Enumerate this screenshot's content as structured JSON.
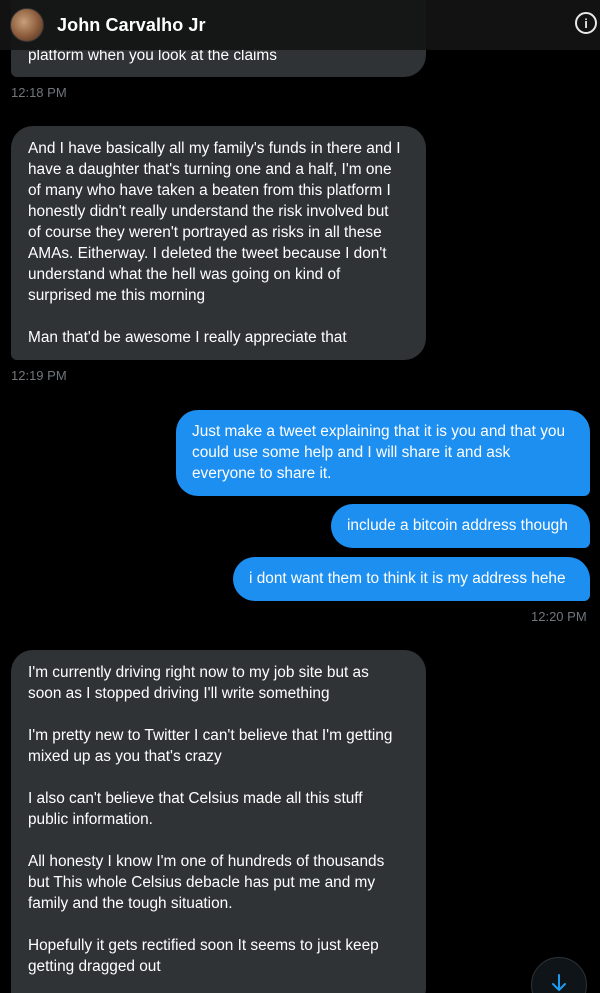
{
  "header": {
    "contact_name": "John Carvalho Jr",
    "info_icon": "info-icon"
  },
  "messages": [
    {
      "type": "received",
      "text": "platform when you look at the claims"
    },
    {
      "type": "timestamp",
      "text": "12:18 PM"
    },
    {
      "type": "received",
      "paragraphs": [
        "And I have basically all my family's funds in there and I\nhave a daughter that's turning one and a half, I'm one\nof many who have taken a beaten from this platform I\nhonestly didn't really understand the risk involved but\nof course they weren't portrayed as risks in all these\nAMAs. Eitherway. I deleted the tweet because I don't\nunderstand what the hell was going on kind of\nsurprised me this morning",
        "Man that'd be awesome I really appreciate that"
      ]
    },
    {
      "type": "timestamp",
      "text": "12:19 PM"
    },
    {
      "type": "sent",
      "text": "Just make a tweet explaining that it is you and that you\ncould use some help and I will share it and ask\neveryone to share it."
    },
    {
      "type": "sent",
      "text": "include a bitcoin address though"
    },
    {
      "type": "sent",
      "text": "i dont want them to think it is my address hehe"
    },
    {
      "type": "timestamp",
      "text": "12:20 PM"
    },
    {
      "type": "received",
      "paragraphs": [
        "I'm currently driving right now to my job site but as\nsoon as I stopped driving I'll write something",
        "I'm pretty new to Twitter I can't believe that I'm getting\nmixed up as you that's crazy",
        "I also can't believe that Celsius made all this stuff\npublic information.",
        "All honesty I know I'm one of hundreds of thousands\nbut This whole Celsius debacle has put me and my\nfamily and the tough situation.",
        "Hopefully it gets rectified soon It seems to just keep\ngetting dragged out"
      ]
    }
  ],
  "colors": {
    "background": "#000000",
    "received_bubble": "#2f3336",
    "sent_bubble": "#1d8ff0",
    "timestamp": "#71767b"
  },
  "scroll_button_icon": "arrow-down-icon"
}
